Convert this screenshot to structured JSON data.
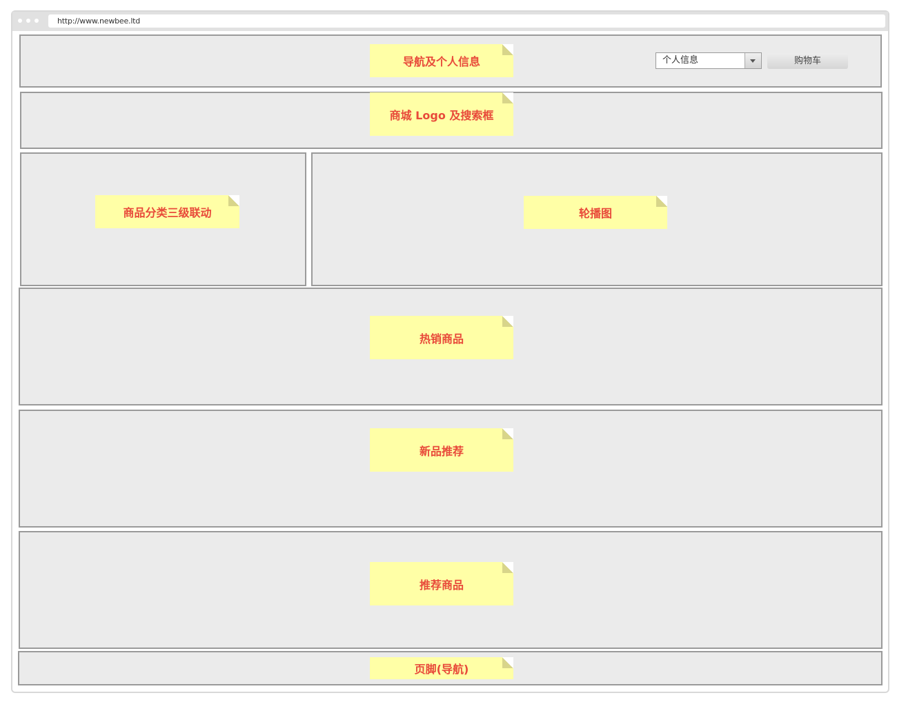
{
  "browser": {
    "url": "http://www.newbee.ltd"
  },
  "sections": {
    "nav": {
      "label": "导航及个人信息"
    },
    "logo_search": {
      "label": "商城 Logo 及搜索框"
    },
    "category": {
      "label": "商品分类三级联动"
    },
    "carousel": {
      "label": "轮播图"
    },
    "hot": {
      "label": "热销商品"
    },
    "new": {
      "label": "新品推荐"
    },
    "recommend": {
      "label": "推荐商品"
    },
    "footer": {
      "label": "页脚(导航)"
    }
  },
  "header": {
    "profile_select": {
      "value": "个人信息"
    },
    "cart_button": {
      "label": "购物车"
    }
  },
  "colors": {
    "panel_bg": "#ebebeb",
    "panel_border": "#9a9a9a",
    "note_bg": "#ffffa6",
    "note_text": "#e84a3a"
  }
}
